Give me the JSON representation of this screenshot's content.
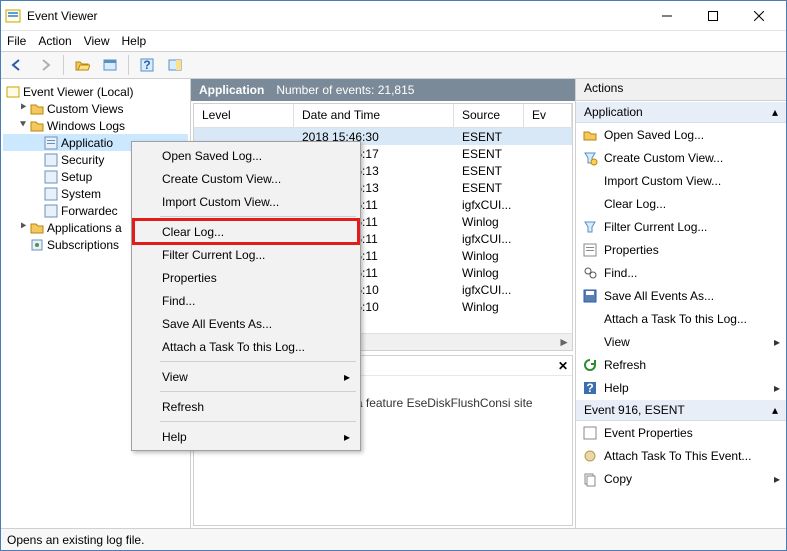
{
  "window": {
    "title": "Event Viewer"
  },
  "menu": {
    "file": "File",
    "action": "Action",
    "view": "View",
    "help": "Help"
  },
  "tree": {
    "root": "Event Viewer (Local)",
    "custom_views": "Custom Views",
    "windows_logs": "Windows Logs",
    "application": "Applicatio",
    "security": "Security",
    "setup": "Setup",
    "system": "System",
    "forwarded": "Forwardec",
    "apps_services": "Applications a",
    "subscriptions": "Subscriptions"
  },
  "center": {
    "head": "Application",
    "subhead": "Number of events: 21,815",
    "cols": {
      "level": "Level",
      "date": "Date and Time",
      "source": "Source",
      "ev": "Ev"
    },
    "rows": [
      {
        "date": "2018 15:46:30",
        "source": "ESENT"
      },
      {
        "date": "2018 15:46:17",
        "source": "ESENT"
      },
      {
        "date": "2018 15:46:13",
        "source": "ESENT"
      },
      {
        "date": "2018 15:46:13",
        "source": "ESENT"
      },
      {
        "date": "2018 15:46:11",
        "source": "igfxCUI..."
      },
      {
        "date": "2018 15:46:11",
        "source": "Winlog"
      },
      {
        "date": "2018 15:46:11",
        "source": "igfxCUI..."
      },
      {
        "date": "2018 15:46:11",
        "source": "Winlog"
      },
      {
        "date": "2018 15:46:11",
        "source": "Winlog"
      },
      {
        "date": "2018 15:46:10",
        "source": "igfxCUI..."
      },
      {
        "date": "2018 15:46:10",
        "source": "Winlog"
      }
    ],
    "detail": "svchost (5784,G,98) The beta feature EseDiskFlushConsi site mode settings 0x800000."
  },
  "context_menu": {
    "open_saved": "Open Saved Log...",
    "create_custom": "Create Custom View...",
    "import_custom": "Import Custom View...",
    "clear_log": "Clear Log...",
    "filter": "Filter Current Log...",
    "properties": "Properties",
    "find": "Find...",
    "save_all": "Save All Events As...",
    "attach_task": "Attach a Task To this Log...",
    "view": "View",
    "refresh": "Refresh",
    "help": "Help"
  },
  "actions": {
    "title": "Actions",
    "section1": "Application",
    "open_saved": "Open Saved Log...",
    "create_custom": "Create Custom View...",
    "import_custom": "Import Custom View...",
    "clear_log": "Clear Log...",
    "filter": "Filter Current Log...",
    "properties": "Properties",
    "find": "Find...",
    "save_all": "Save All Events As...",
    "attach_task": "Attach a Task To this Log...",
    "view": "View",
    "refresh": "Refresh",
    "help": "Help",
    "section2": "Event 916, ESENT",
    "event_props": "Event Properties",
    "attach_event": "Attach Task To This Event...",
    "copy": "Copy"
  },
  "status": "Opens an existing log file."
}
